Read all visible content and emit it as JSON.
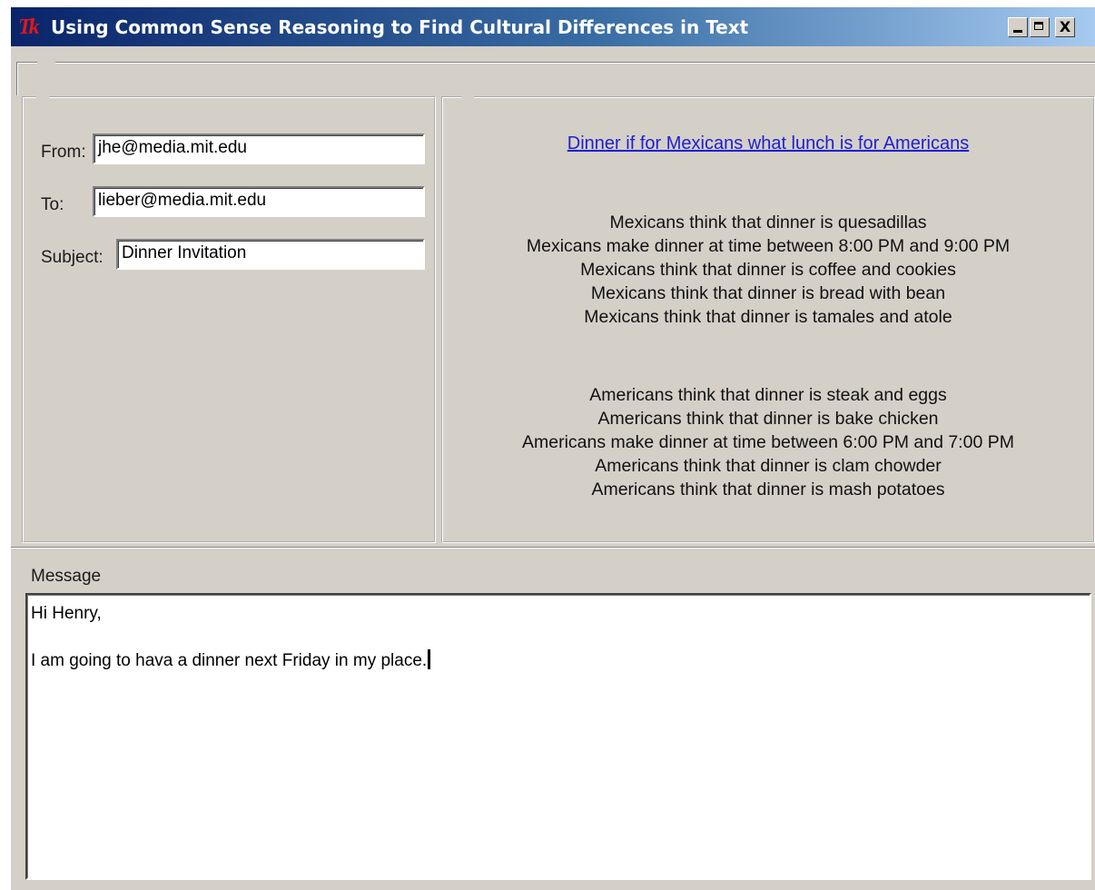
{
  "window": {
    "title": "Using Common Sense Reasoning to Find Cultural Differences in Text",
    "app_icon": "Tk",
    "controls": {
      "minimize": "_",
      "maximize": "□",
      "close": "X"
    }
  },
  "header_fields": {
    "from_label": "From:",
    "from_value": "jhe@media.mit.edu",
    "to_label": "To:",
    "to_value": "lieber@media.mit.edu",
    "subject_label": "Subject:",
    "subject_value": "Dinner Invitation"
  },
  "analysis": {
    "link": "Dinner if for Mexicans what lunch is for Americans",
    "mexican_facts": [
      "Mexicans think that dinner is quesadillas",
      "Mexicans make dinner at time between 8:00 PM and 9:00 PM",
      "Mexicans think that dinner is coffee and cookies",
      "Mexicans think that dinner is bread with bean",
      "Mexicans think that dinner is tamales and atole"
    ],
    "american_facts": [
      "Americans think that dinner is steak and eggs",
      "Americans think that dinner is bake chicken",
      "Americans make dinner at time between 6:00 PM and 7:00 PM",
      "Americans think that dinner is clam chowder",
      "Americans think that dinner is mash potatoes"
    ]
  },
  "message": {
    "label": "Message",
    "line1": "Hi Henry,",
    "line2": "I am going to hava a dinner next Friday in my place."
  },
  "colors": {
    "face": "#d4d0c8",
    "titlebar_start": "#0a246a",
    "titlebar_end": "#a6caf0",
    "link": "#1f1fd0",
    "icon": "#e01818"
  }
}
